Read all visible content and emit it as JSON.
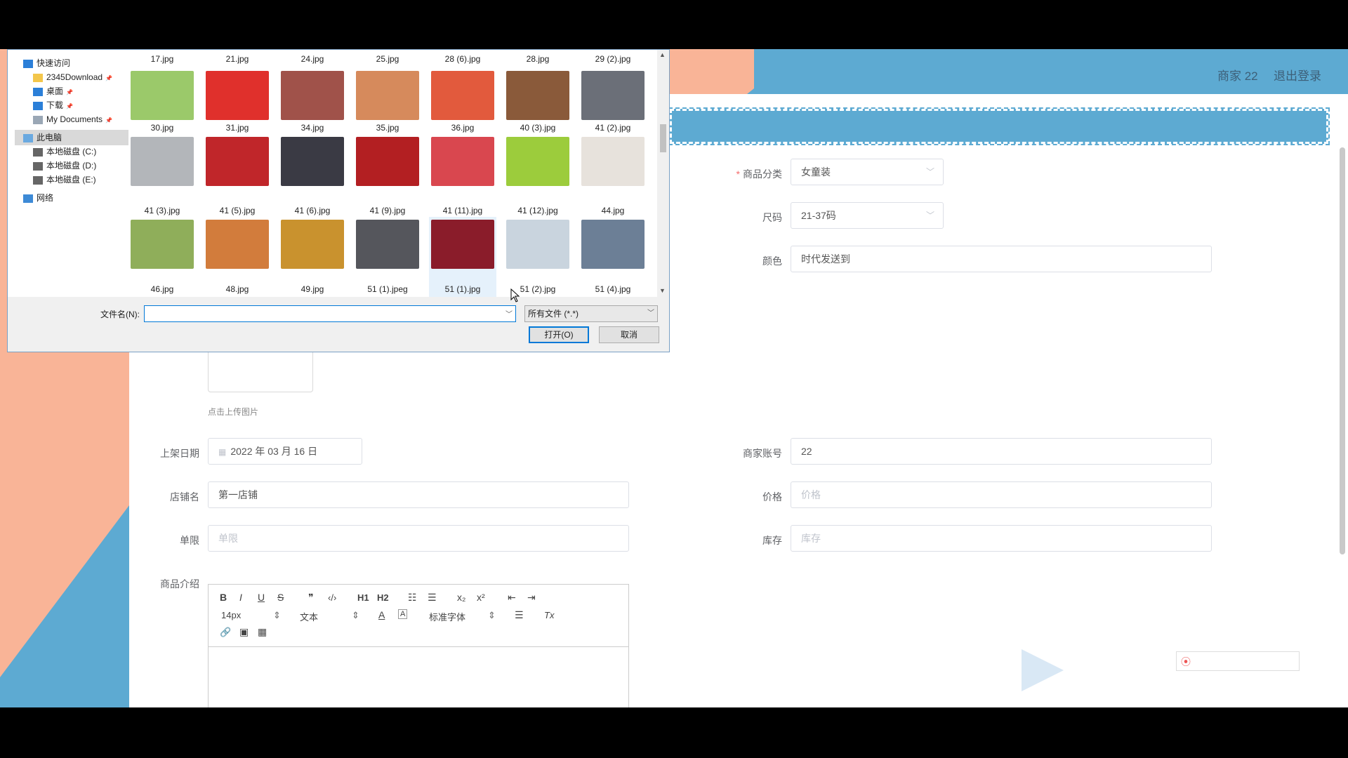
{
  "header": {
    "merchant_label": "商家 22",
    "logout_label": "退出登录"
  },
  "form": {
    "category": {
      "label": "商品分类",
      "value": "女童装"
    },
    "size": {
      "label": "尺码",
      "value": "21-37码"
    },
    "color": {
      "label": "颜色",
      "value": "时代发送到"
    },
    "upload_hint": "点击上传图片",
    "date": {
      "label": "上架日期",
      "value": "2022 年 03 月 16 日"
    },
    "merchant_account": {
      "label": "商家账号",
      "value": "22"
    },
    "shop": {
      "label": "店铺名",
      "value": "第一店铺"
    },
    "price": {
      "label": "价格",
      "placeholder": "价格"
    },
    "limit": {
      "label": "单限",
      "placeholder": "单限"
    },
    "stock": {
      "label": "库存",
      "placeholder": "库存"
    },
    "intro": {
      "label": "商品介绍"
    }
  },
  "editor": {
    "bold": "B",
    "italic": "I",
    "underline": "U",
    "strike": "S",
    "quote": "❞",
    "code": "‹/›",
    "h1": "H1",
    "h2": "H2",
    "ol": "☷",
    "ul": "☰",
    "sub": "x₂",
    "sup": "x²",
    "outdent": "⇤",
    "indent": "⇥",
    "font_size": "14px",
    "block_type": "文本",
    "font_color": "A",
    "font_bg": "A",
    "font_family": "标准字体",
    "align": "☰",
    "clear": "Tx",
    "link": "🔗",
    "image": "▣",
    "video": "▦"
  },
  "dialog": {
    "nav": [
      {
        "label": "快速访问",
        "icon": "star-icon",
        "pinned": false
      },
      {
        "label": "2345Download",
        "icon": "folder-icon",
        "pinned": true
      },
      {
        "label": "桌面",
        "icon": "desktop-icon",
        "pinned": true
      },
      {
        "label": "下载",
        "icon": "download-icon",
        "pinned": true
      },
      {
        "label": "My Documents",
        "icon": "documents-icon",
        "pinned": true
      },
      {
        "label": "此电脑",
        "icon": "computer-icon",
        "pinned": false
      },
      {
        "label": "本地磁盘 (C:)",
        "icon": "drive-icon",
        "pinned": false
      },
      {
        "label": "本地磁盘 (D:)",
        "icon": "drive-icon",
        "pinned": false
      },
      {
        "label": "本地磁盘 (E:)",
        "icon": "drive-icon",
        "pinned": false
      },
      {
        "label": "网络",
        "icon": "network-icon",
        "pinned": false
      }
    ],
    "top_files": [
      "17.jpg",
      "21.jpg",
      "24.jpg",
      "25.jpg",
      "28 (6).jpg",
      "28.jpg",
      "29 (2).jpg"
    ],
    "rows": [
      [
        {
          "name": "30.jpg",
          "color": "#9bc96a"
        },
        {
          "name": "31.jpg",
          "color": "#e0302c"
        },
        {
          "name": "34.jpg",
          "color": "#a0524a"
        },
        {
          "name": "35.jpg",
          "color": "#d68a5c"
        },
        {
          "name": "36.jpg",
          "color": "#e25a3d"
        },
        {
          "name": "40 (3).jpg",
          "color": "#8a5a3a"
        },
        {
          "name": "41 (2).jpg",
          "color": "#6b6f78"
        }
      ],
      [
        {
          "name": "41 (3).jpg",
          "color": "#b3b6ba"
        },
        {
          "name": "41 (5).jpg",
          "color": "#c0262a"
        },
        {
          "name": "41 (6).jpg",
          "color": "#3a3a44"
        },
        {
          "name": "41 (9).jpg",
          "color": "#b31f22"
        },
        {
          "name": "41 (11).jpg",
          "color": "#d9474f"
        },
        {
          "name": "41 (12).jpg",
          "color": "#9ccc3c"
        },
        {
          "name": "44.jpg",
          "color": "#e7e2dc"
        }
      ],
      [
        {
          "name": "46.jpg",
          "color": "#8fae5a"
        },
        {
          "name": "48.jpg",
          "color": "#d27c3c"
        },
        {
          "name": "49.jpg",
          "color": "#c9922e"
        },
        {
          "name": "51 (1).jpeg",
          "color": "#55565c"
        },
        {
          "name": "51 (1).jpg",
          "color": "#8a1c2a"
        },
        {
          "name": "51 (2).jpg",
          "color": "#c9d4de"
        },
        {
          "name": "51 (4).jpg",
          "color": "#6c7f96"
        }
      ]
    ],
    "filename_label": "文件名(N):",
    "filename_value": "",
    "filter_value": "所有文件 (*.*)",
    "open_label": "打开(O)",
    "cancel_label": "取消"
  },
  "colors": {
    "accent_blue": "#5daad2",
    "accent_salmon": "#f9b497",
    "focus": "#0078d7"
  }
}
